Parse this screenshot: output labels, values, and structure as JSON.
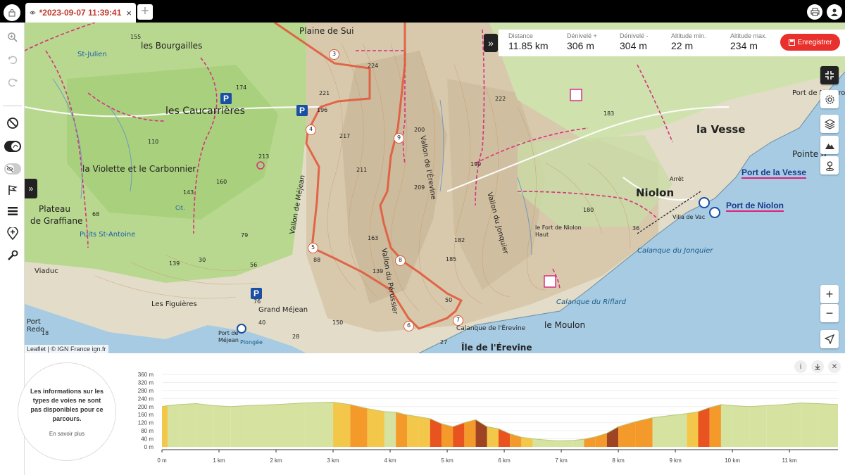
{
  "tab": {
    "title": "*2023-09-07 11:39:41",
    "close": "×",
    "add": "+"
  },
  "stats": [
    {
      "label": "Distance",
      "value": "11.85 km"
    },
    {
      "label": "Dénivelé +",
      "value": "306 m"
    },
    {
      "label": "Dénivelé -",
      "value": "304 m"
    },
    {
      "label": "Altitude min.",
      "value": "22 m"
    },
    {
      "label": "Altitude max.",
      "value": "234 m"
    }
  ],
  "save_button": "Enregistrer",
  "attribution": "Leaflet | © IGN France ign.fr",
  "map": {
    "places": {
      "plaine_de_sui": "Plaine de Sui",
      "les_bourgailles": "les Bourgailles",
      "les_caucarrieres": "les  Caucarrières",
      "la_violette": "la Violette et le Carbonnier",
      "plateau": "Plateau",
      "de_graffiane": "de Graffiane",
      "les_figuieres": "Les Figuières",
      "grand_mejean": "Grand Méjean",
      "port_de_mejean": "Port\nde\nMéjean",
      "plongee": "Plongée",
      "port_red": "Port\nRedo",
      "viaduc": "Viaduc",
      "la_vesse": "la Vesse",
      "niolon": "Niolon",
      "pointe": "Pointe d",
      "port_de_figuerolles": "Port de Figuerol",
      "le_fort": "le Fort\nde Niolon Haut",
      "le_moulon": "le Moulon",
      "ile_erevine": "Île de l'Érevine",
      "calanque_jonquier": "Calanque du Jonquier",
      "calanque_riflard": "Calanque du Riflard",
      "calanque_erevine": "Calanque de l'Érevine",
      "vallon_mejean": "Vallon de Méjean",
      "vallon_perussier": "Vallon du Pérussier",
      "vallon_erevine": "Vallon de l'Érevine",
      "vallon_jonquier": "Vallon du Jonquier",
      "puits_st_antoine": "Puits St-Antoine",
      "st_julien": "St-Julien",
      "villa": "Villa de Vac",
      "anse": "Arrêt",
      "cit": "Cit."
    },
    "ports": {
      "port_vesse": "Port de la Vesse",
      "port_niolon": "Port de Niolon"
    },
    "waypoints": [
      "3",
      "4",
      "5",
      "6",
      "7",
      "8",
      "9"
    ],
    "elevations": [
      "155",
      "174",
      "221",
      "196",
      "217",
      "224",
      "213",
      "143",
      "160",
      "110",
      "68",
      "79",
      "56",
      "139",
      "88",
      "30",
      "150",
      "76",
      "40",
      "200",
      "211",
      "209",
      "182",
      "185",
      "163",
      "139",
      "50",
      "222",
      "199",
      "183",
      "180",
      "36",
      "27",
      "28",
      "18"
    ]
  },
  "profile": {
    "info_text": "Les informations sur les types de voies ne sont pas disponibles pour ce parcours.",
    "info_link": "En savoir plus",
    "y_ticks": [
      "360 m",
      "320 m",
      "280 m",
      "240 m",
      "200 m",
      "160 m",
      "120 m",
      "80 m",
      "40 m",
      "0 m"
    ],
    "x_ticks": [
      "0 m",
      "1 km",
      "2 km",
      "3 km",
      "4 km",
      "5 km",
      "6 km",
      "7 km",
      "8 km",
      "9 km",
      "10 km",
      "11 km"
    ]
  },
  "chart_data": {
    "type": "area",
    "title": "",
    "xlabel": "",
    "ylabel": "",
    "x_unit": "km",
    "y_unit": "m",
    "xlim": [
      0,
      11.85
    ],
    "ylim": [
      0,
      360
    ],
    "x": [
      0,
      0.1,
      0.3,
      0.6,
      0.9,
      1.2,
      1.5,
      2.0,
      2.5,
      3.0,
      3.3,
      3.6,
      3.9,
      4.1,
      4.3,
      4.5,
      4.7,
      4.9,
      5.1,
      5.3,
      5.5,
      5.7,
      5.9,
      6.1,
      6.3,
      6.5,
      6.7,
      6.9,
      7.0,
      7.2,
      7.4,
      7.6,
      7.8,
      8.0,
      8.3,
      8.6,
      8.9,
      9.2,
      9.4,
      9.6,
      9.8,
      10.0,
      10.3,
      10.6,
      10.9,
      11.2,
      11.5,
      11.85
    ],
    "y": [
      200,
      205,
      210,
      215,
      205,
      200,
      205,
      210,
      218,
      222,
      210,
      190,
      175,
      172,
      158,
      150,
      140,
      115,
      100,
      120,
      135,
      100,
      90,
      65,
      48,
      40,
      35,
      30,
      30,
      32,
      38,
      50,
      68,
      100,
      125,
      145,
      155,
      165,
      175,
      195,
      210,
      205,
      200,
      205,
      210,
      218,
      215,
      210
    ]
  }
}
